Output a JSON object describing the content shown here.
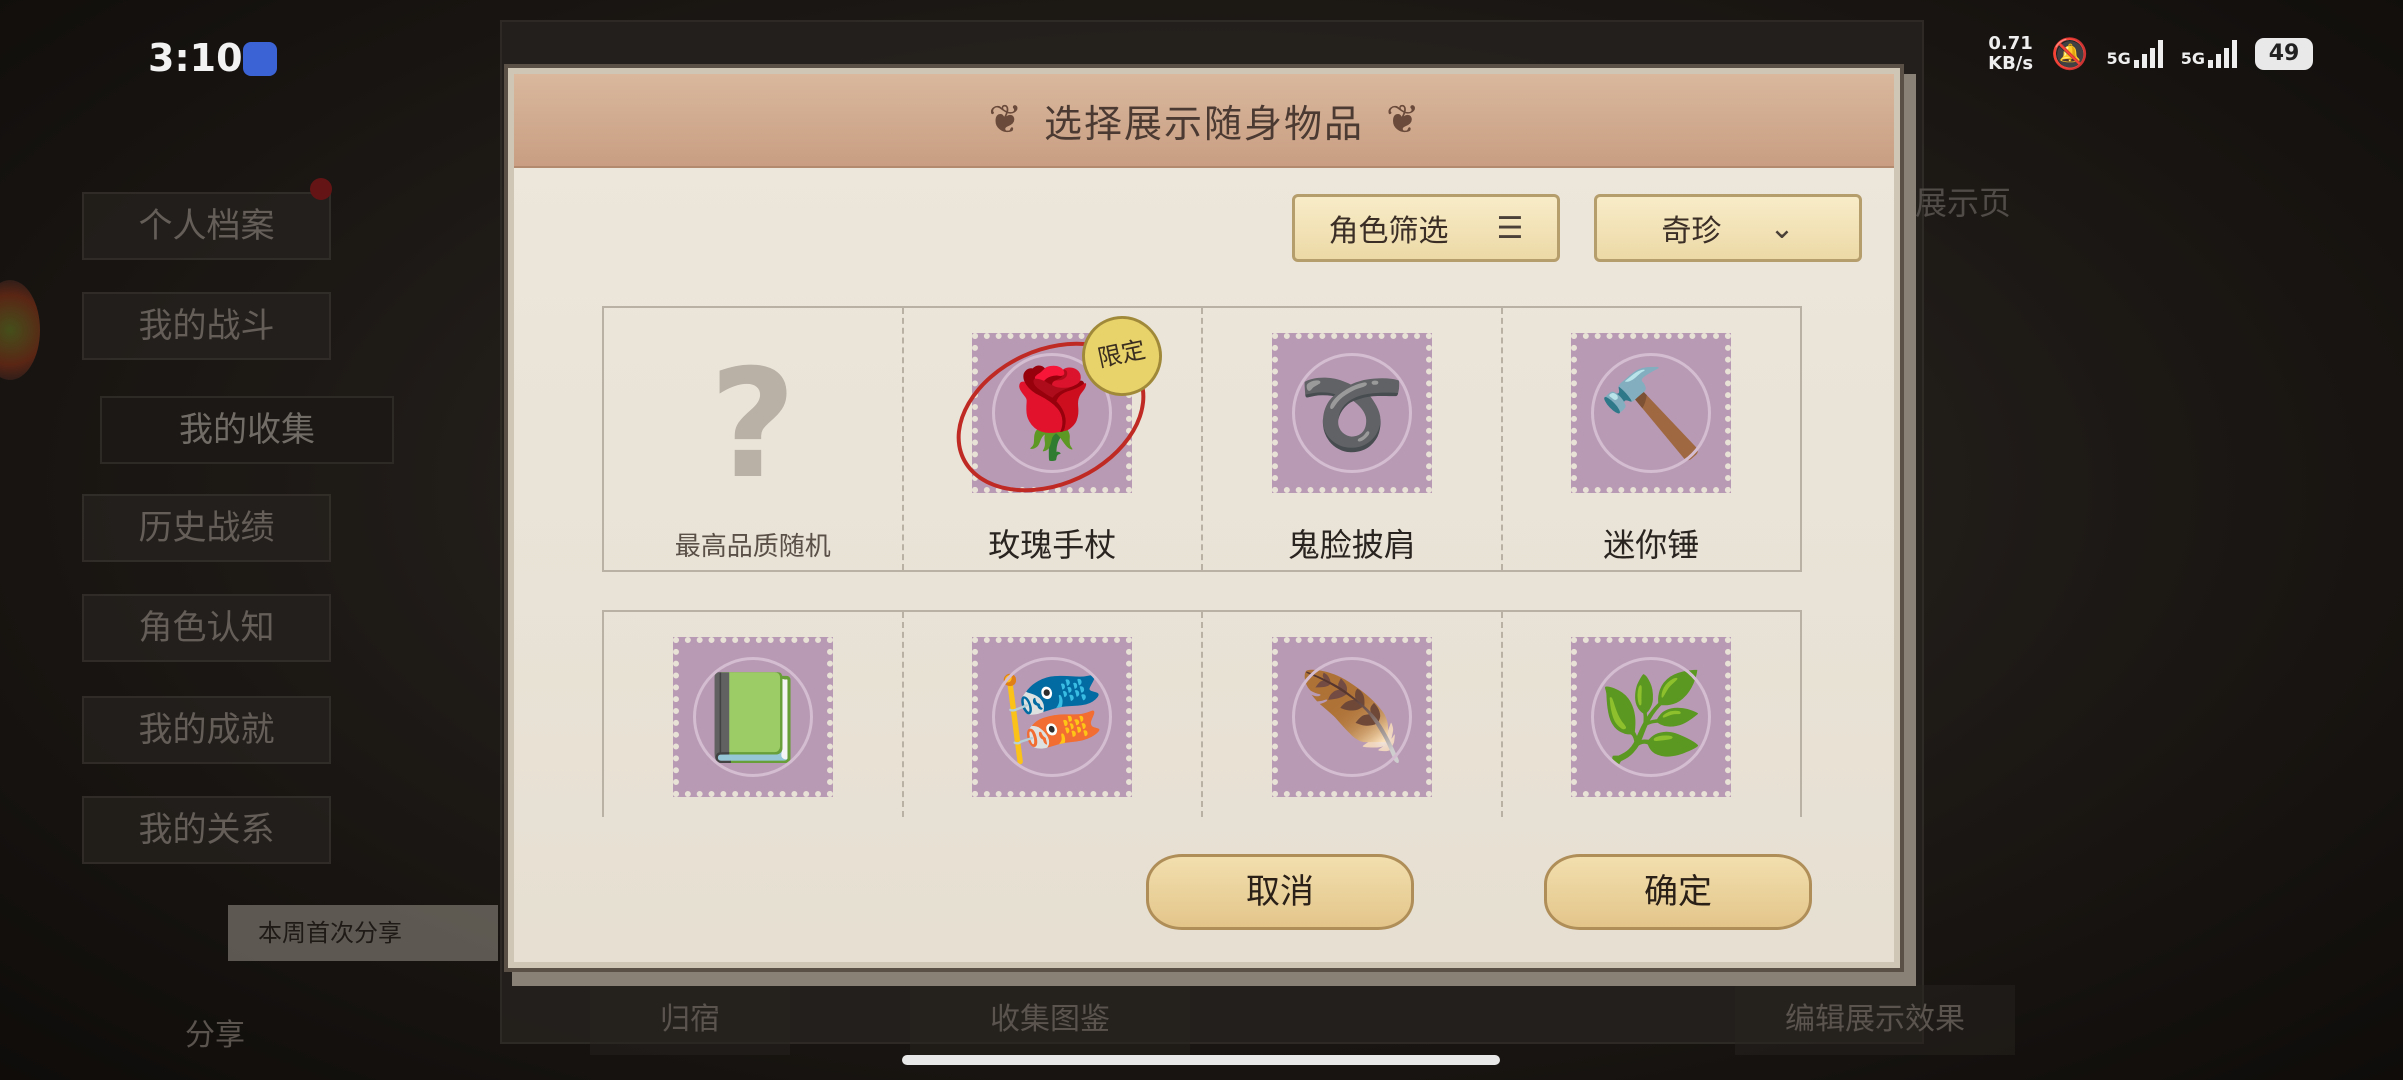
{
  "status_bar": {
    "time": "3:10",
    "net_speed_value": "0.71",
    "net_speed_unit": "KB/s",
    "sim1": "5G",
    "sim2": "5G",
    "battery": "49"
  },
  "side_menu": {
    "items": [
      {
        "label": "个人档案"
      },
      {
        "label": "我的战斗"
      },
      {
        "label": "我的收集"
      },
      {
        "label": "历史战绩"
      },
      {
        "label": "角色认知"
      },
      {
        "label": "我的成就"
      },
      {
        "label": "我的关系"
      }
    ],
    "share_tag": "本周首次分享",
    "share_label": "分享"
  },
  "background": {
    "right_text": "展示页",
    "bottom_tabs": [
      "归宿",
      "收集图鉴",
      "编辑展示效果"
    ]
  },
  "dialog": {
    "title": "选择展示随身物品",
    "role_filter_label": "角色筛选",
    "category_select_value": "奇珍",
    "items_row1": [
      {
        "label": "最高品质随机",
        "icon": "question-mark-icon"
      },
      {
        "label": "玫瑰手杖",
        "icon": "rose-cane-icon",
        "badge": "限定"
      },
      {
        "label": "鬼脸披肩",
        "icon": "scarf-icon"
      },
      {
        "label": "迷你锤",
        "icon": "mini-hammer-icon"
      }
    ],
    "items_row2": [
      {
        "icon": "green-book-icon"
      },
      {
        "icon": "red-banner-icon"
      },
      {
        "icon": "feather-staff-icon"
      },
      {
        "icon": "golden-branch-icon"
      }
    ],
    "cancel_label": "取消",
    "confirm_label": "确定"
  }
}
